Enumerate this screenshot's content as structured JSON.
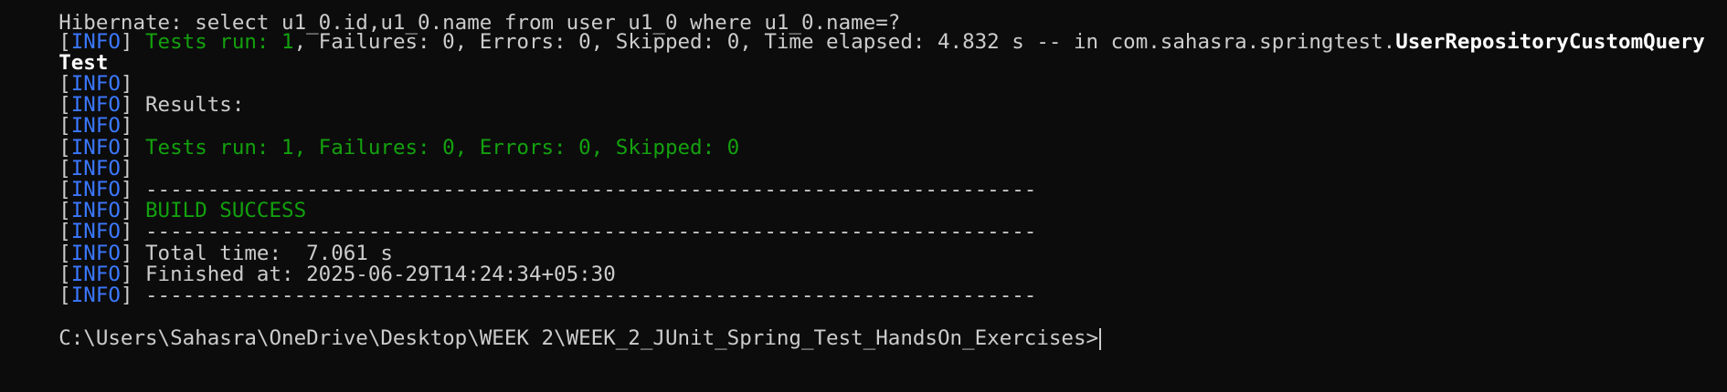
{
  "terminal": {
    "background": "#0c0c0c",
    "colors": {
      "info_tag": "#3b78ff",
      "success": "#13a10e",
      "text": "#cccccc",
      "bold": "#ffffff"
    },
    "clipped_line": "Hibernate: select u1_0.id,u1_0.name from user u1_0 where u1_0.name=?",
    "info_label": "INFO",
    "line1": {
      "tests_run": "Tests run: 1",
      "rest": ", Failures: 0, Errors: 0, Skipped: 0, Time elapsed: 4.832 s -- in com.sahasra.springtest.",
      "class_name": "UserRepositoryCustomQuery"
    },
    "line2_wrap": "Test",
    "results_label": "Results:",
    "summary": "Tests run: 1, Failures: 0, Errors: 0, Skipped: 0",
    "separator": "------------------------------------------------------------------------",
    "build_status": "BUILD SUCCESS",
    "total_time": "Total time:  7.061 s",
    "finished_at": "Finished at: 2025-06-29T14:24:34+05:30",
    "prompt": "C:\\Users\\Sahasra\\OneDrive\\Desktop\\WEEK 2\\WEEK_2_JUnit_Spring_Test_HandsOn_Exercises>"
  }
}
